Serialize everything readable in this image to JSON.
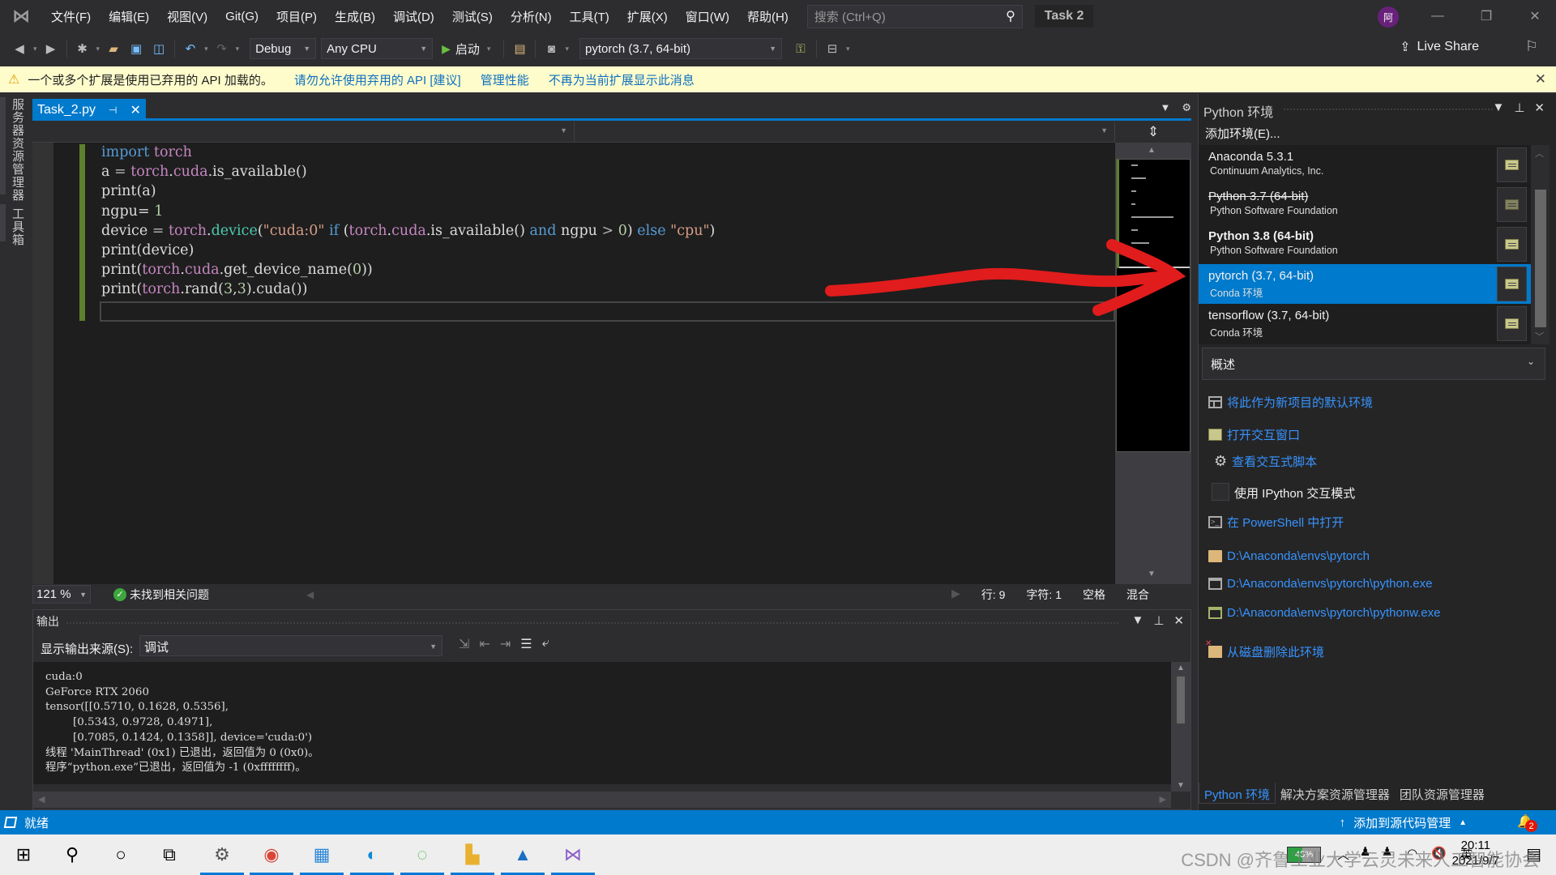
{
  "menubar": {
    "items": [
      "文件(F)",
      "编辑(E)",
      "视图(V)",
      "Git(G)",
      "项目(P)",
      "生成(B)",
      "调试(D)",
      "测试(S)",
      "分析(N)",
      "工具(T)",
      "扩展(X)",
      "窗口(W)",
      "帮助(H)"
    ],
    "search_placeholder": "搜索 (Ctrl+Q)",
    "solution_name": "Task 2",
    "avatar_initial": "阿"
  },
  "toolbar": {
    "config": "Debug",
    "platform": "Any CPU",
    "start_label": "启动",
    "environment": "pytorch (3.7, 64-bit)",
    "live_share": "Live Share"
  },
  "infobar": {
    "message": "一个或多个扩展是使用已弃用的 API 加载的。",
    "links": [
      "请勿允许使用弃用的 API [建议]",
      "管理性能",
      "不再为当前扩展显示此消息"
    ]
  },
  "left_strip": {
    "tabs": [
      "服务器资源管理器",
      "工具箱"
    ]
  },
  "editor": {
    "tab_title": "Task_2.py",
    "zoom": "121 %",
    "issues": "未找到相关问题",
    "line": "行: 9",
    "char": "字符: 1",
    "indent": "空格",
    "eol": "混合"
  },
  "output": {
    "title": "输出",
    "source_label": "显示输出来源(S):",
    "source_value": "调试",
    "text": "cuda:0\nGeForce RTX 2060\ntensor([[0.5710, 0.1628, 0.5356],\n        [0.5343, 0.9728, 0.4971],\n        [0.7085, 0.1424, 0.1358]], device='cuda:0')\n线程 'MainThread' (0x1) 已退出，返回值为 0 (0x0)。\n程序“python.exe”已退出，返回值为 -1 (0xffffffff)。"
  },
  "env_pane": {
    "title": "Python 环境",
    "add_env": "添加环境(E)...",
    "environments": [
      {
        "name": "Anaconda 5.3.1",
        "sub": "Continuum Analytics, Inc.",
        "style": "normal",
        "selected": false
      },
      {
        "name": "Python 3.7 (64-bit)",
        "sub": "Python Software Foundation",
        "style": "strike",
        "selected": false
      },
      {
        "name": "Python 3.8 (64-bit)",
        "sub": "Python Software Foundation",
        "style": "bold",
        "selected": false
      },
      {
        "name": "pytorch (3.7, 64-bit)",
        "sub": "Conda 环境",
        "style": "normal",
        "selected": true
      },
      {
        "name": "tensorflow (3.7, 64-bit)",
        "sub": "Conda 环境",
        "style": "normal",
        "selected": false
      }
    ],
    "view": "概述",
    "actions": {
      "set_default": "将此作为新项目的默认环境",
      "open_interactive": "打开交互窗口",
      "view_scripts": "查看交互式脚本",
      "use_ipython": "使用 IPython 交互模式",
      "open_powershell": "在 PowerShell 中打开",
      "env_path": "D:\\Anaconda\\envs\\pytorch",
      "python_exe": "D:\\Anaconda\\envs\\pytorch\\python.exe",
      "pythonw_exe": "D:\\Anaconda\\envs\\pytorch\\pythonw.exe",
      "delete_env": "从磁盘删除此环境"
    },
    "bottom_tabs": [
      "Python 环境",
      "解决方案资源管理器",
      "团队资源管理器"
    ]
  },
  "statusbar": {
    "ready": "就绪",
    "source_control": "添加到源代码管理",
    "notifications": "2"
  },
  "taskbar": {
    "battery": "45%",
    "time": "20:11",
    "date": "2021/9/7",
    "ime": "英",
    "watermark": "CSDN @齐鲁工业大学云灵未来人工智能协会"
  },
  "colors": {
    "accent": "#007acc",
    "infobar_bg": "#fffccc",
    "link": "#3794ff",
    "annotation_red": "#e11c1c"
  }
}
